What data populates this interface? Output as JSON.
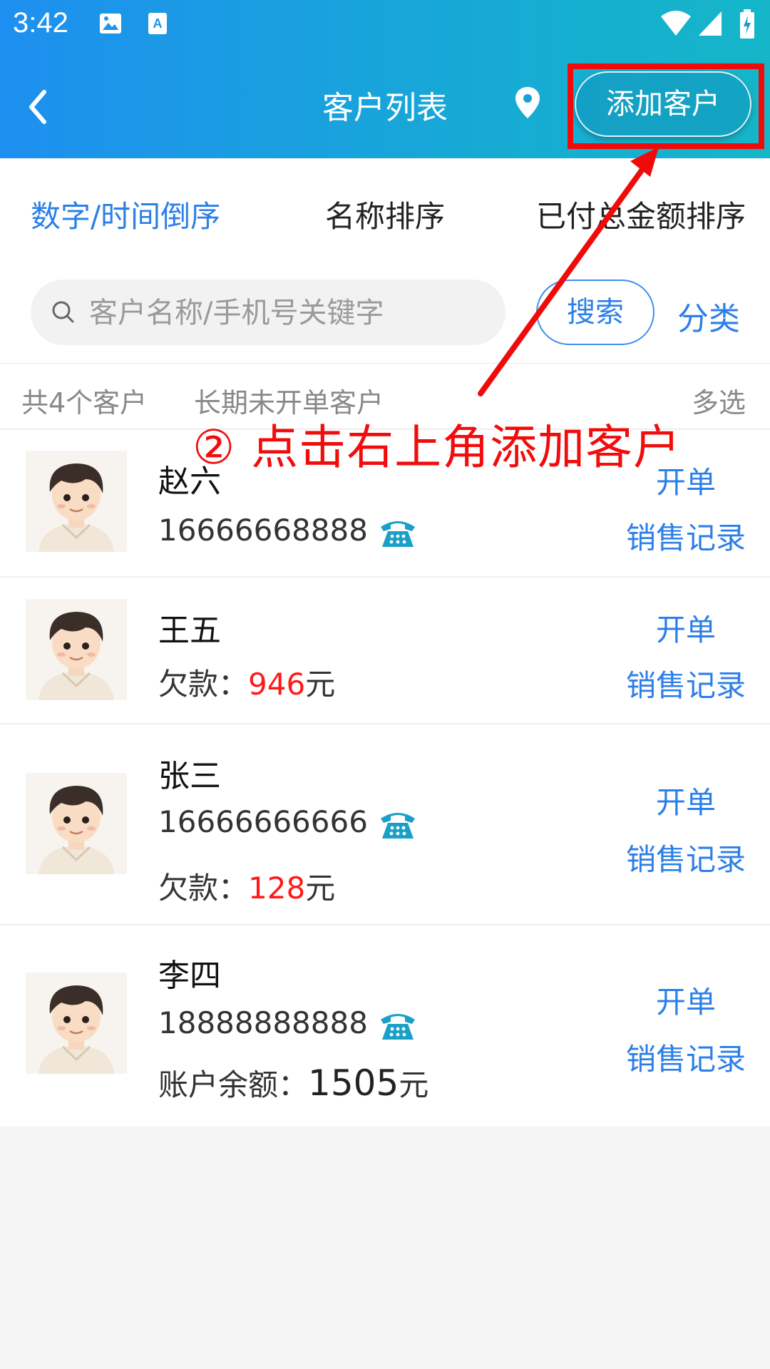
{
  "status_bar": {
    "time": "3:42",
    "icons": [
      "image-icon",
      "text-a-icon",
      "wifi-icon",
      "signal-icon",
      "battery-charging-icon"
    ]
  },
  "navbar": {
    "title": "客户列表",
    "add_button": "添加客户",
    "icons": [
      "back-icon",
      "location-pin-icon"
    ]
  },
  "sort_tabs": [
    {
      "label": "数字/时间倒序",
      "active": true
    },
    {
      "label": "名称排序",
      "active": false
    },
    {
      "label": "已付总金额排序",
      "active": false
    }
  ],
  "search": {
    "placeholder": "客户名称/手机号关键字",
    "button": "搜索",
    "category": "分类"
  },
  "summary": {
    "count_text": "共4个客户",
    "inactive_text": "长期未开单客户",
    "multi_select": "多选"
  },
  "customers": [
    {
      "name": "赵六",
      "phone": "16666668888",
      "order": "开单",
      "records": "销售记录"
    },
    {
      "name": "王五",
      "debt_label": "欠款：",
      "debt_value": "946",
      "unit": "元",
      "order": "开单",
      "records": "销售记录"
    },
    {
      "name": "张三",
      "phone": "16666666666",
      "debt_label": "欠款：",
      "debt_value": "128",
      "unit": "元",
      "order": "开单",
      "records": "销售记录"
    },
    {
      "name": "李四",
      "phone": "18888888888",
      "balance_label": "账户余额：",
      "balance_value": "1505",
      "unit": "元",
      "order": "开单",
      "records": "销售记录"
    }
  ],
  "annotation": {
    "text": "② 点击右上角添加客户"
  },
  "colors": {
    "accent": "#2c7fe8",
    "header_start": "#1e8ff0",
    "header_end": "#15b6c8",
    "highlight": "#f00a0a",
    "debt": "#ff1a1a",
    "phone_icon": "#1aa0c8"
  }
}
